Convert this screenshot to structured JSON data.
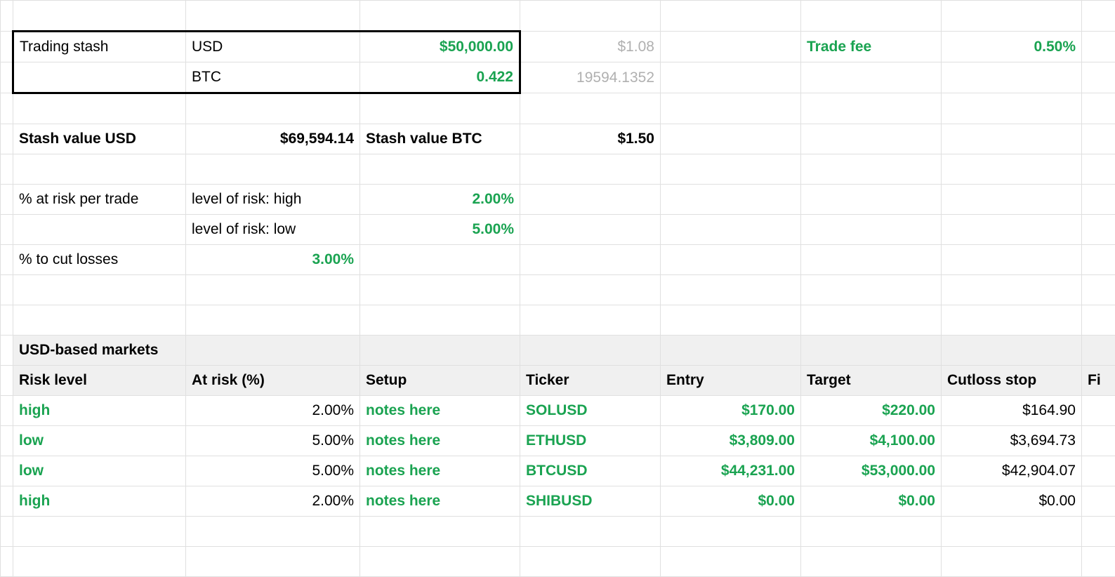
{
  "stash": {
    "label": "Trading stash",
    "usd_label": "USD",
    "usd_value": "$50,000.00",
    "btc_label": "BTC",
    "btc_value": "0.422",
    "side_usd": "$1.08",
    "side_btc": "19594.1352",
    "fee_label": "Trade fee",
    "fee_value": "0.50%"
  },
  "valuation": {
    "usd_label": "Stash value USD",
    "usd_value": "$69,594.14",
    "btc_label": "Stash value BTC",
    "btc_value": "$1.50"
  },
  "risk": {
    "per_trade_label": "% at risk per trade",
    "high_label": "level of risk: high",
    "high_value": "2.00%",
    "low_label": "level of risk: low",
    "low_value": "5.00%",
    "cut_label": "% to cut losses",
    "cut_value": "3.00%"
  },
  "section": {
    "title": "USD-based markets"
  },
  "columns": {
    "risk": "Risk level",
    "at_risk": "At risk (%)",
    "setup": "Setup",
    "ticker": "Ticker",
    "entry": "Entry",
    "target": "Target",
    "cutloss": "Cutloss stop",
    "final": "Fi"
  },
  "rows": [
    {
      "risk": "high",
      "at_risk": "2.00%",
      "setup": "notes here",
      "ticker": "SOLUSD",
      "entry": "$170.00",
      "target": "$220.00",
      "cutloss": "$164.90"
    },
    {
      "risk": "low",
      "at_risk": "5.00%",
      "setup": "notes here",
      "ticker": "ETHUSD",
      "entry": "$3,809.00",
      "target": "$4,100.00",
      "cutloss": "$3,694.73"
    },
    {
      "risk": "low",
      "at_risk": "5.00%",
      "setup": "notes here",
      "ticker": "BTCUSD",
      "entry": "$44,231.00",
      "target": "$53,000.00",
      "cutloss": "$42,904.07"
    },
    {
      "risk": "high",
      "at_risk": "2.00%",
      "setup": "notes here",
      "ticker": "SHIBUSD",
      "entry": "$0.00",
      "target": "$0.00",
      "cutloss": "$0.00"
    }
  ]
}
